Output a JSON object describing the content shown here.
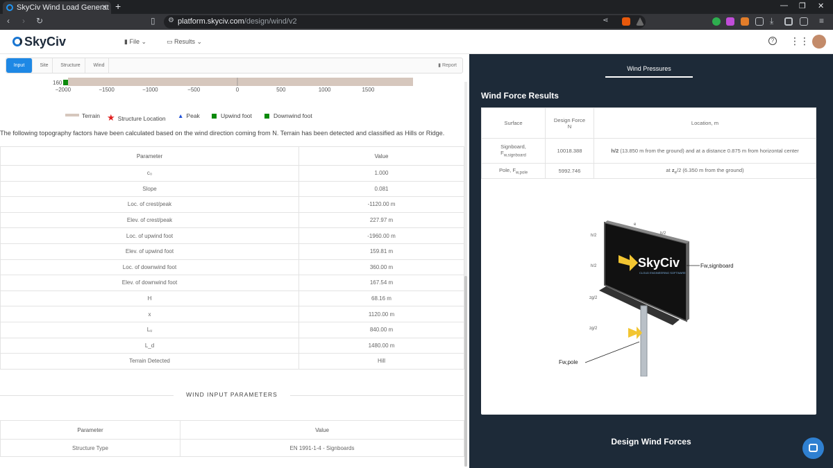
{
  "browser": {
    "tab_title": "SkyCiv Wind Load Generat",
    "tab_close": "✕",
    "new_tab": "+",
    "url_host": "platform.skyciv.com",
    "url_path": "/design/wind/v2"
  },
  "app": {
    "logo": "SkyCiv",
    "menu_file": "File",
    "menu_results": "Results"
  },
  "input_tabs": {
    "items": [
      "Input",
      "Site",
      "Structure",
      "Wind"
    ],
    "report": "Report"
  },
  "terrain_chart": {
    "y_label": "160",
    "x_ticks": [
      "−2000",
      "−1500",
      "−1000",
      "−500",
      "0",
      "500",
      "1000",
      "1500"
    ],
    "x_values": [
      -2000,
      -1500,
      -1000,
      -500,
      0,
      500,
      1000,
      1500
    ],
    "legend": [
      "Terrain",
      "Structure Location",
      "Peak",
      "Upwind foot",
      "Downwind foot"
    ],
    "colors": {
      "terrain": "#d6c7bd",
      "structure": "#e02020",
      "peak": "#1e50d8",
      "foot": "#0b8a0b"
    }
  },
  "topo_text": "The following topography factors have been calculated based on the wind direction coming from N. Terrain has been detected and classified as Hills or Ridge.",
  "topo_table": {
    "headers": [
      "Parameter",
      "Value"
    ],
    "rows": [
      [
        "c₀",
        "1.000"
      ],
      [
        "Slope",
        "0.081"
      ],
      [
        "Loc. of crest/peak",
        "-1120.00 m"
      ],
      [
        "Elev. of crest/peak",
        "227.97 m"
      ],
      [
        "Loc. of upwind foot",
        "-1960.00 m"
      ],
      [
        "Elev. of upwind foot",
        "159.81 m"
      ],
      [
        "Loc. of downwind foot",
        "360.00 m"
      ],
      [
        "Elev. of downwind foot",
        "167.54 m"
      ],
      [
        "H",
        "68.16 m"
      ],
      [
        "x",
        "1120.00 m"
      ],
      [
        "Lᵤ",
        "840.00 m"
      ],
      [
        "L_d",
        "1480.00 m"
      ],
      [
        "Terrain Detected",
        "Hill"
      ]
    ]
  },
  "wind_input": {
    "title": "WIND INPUT PARAMETERS",
    "headers": [
      "Parameter",
      "Value"
    ],
    "rows": [
      [
        "Structure Type",
        "EN 1991-1-4 - Signboards"
      ]
    ]
  },
  "results": {
    "tab": "Wind Pressures",
    "title": "Wind Force Results",
    "headers": [
      "Surface",
      "Design Force\nN",
      "Location, m"
    ],
    "rows": [
      {
        "surface": "Signboard,",
        "surface_sub": "F",
        "surface_subscript": "w,signboard",
        "force": "10018.388",
        "loc_bold": "h/2",
        "loc_rest": " (13.850 m from the ground) and at a distance 0.875 m from horizontal center"
      },
      {
        "surface": "Pole, F",
        "surface_sub": "",
        "surface_subscript": "w,pole",
        "force": "5992.746",
        "loc_bold": "z",
        "loc_rest": "/2 (6.350 m from the ground)"
      }
    ],
    "diagram_labels": {
      "signboard": "Fw,signboard",
      "pole": "Fw,pole",
      "h2a": "h/2",
      "h2b": "h/2",
      "zg2a": "zg/2",
      "zg2b": "zg/2",
      "e": "e",
      "b2": "b/2",
      "board_brand": "SkyCiv",
      "board_tag": "CLOUD ENGINEERING SOFTWARE"
    },
    "footer_title": "Design Wind Forces"
  }
}
